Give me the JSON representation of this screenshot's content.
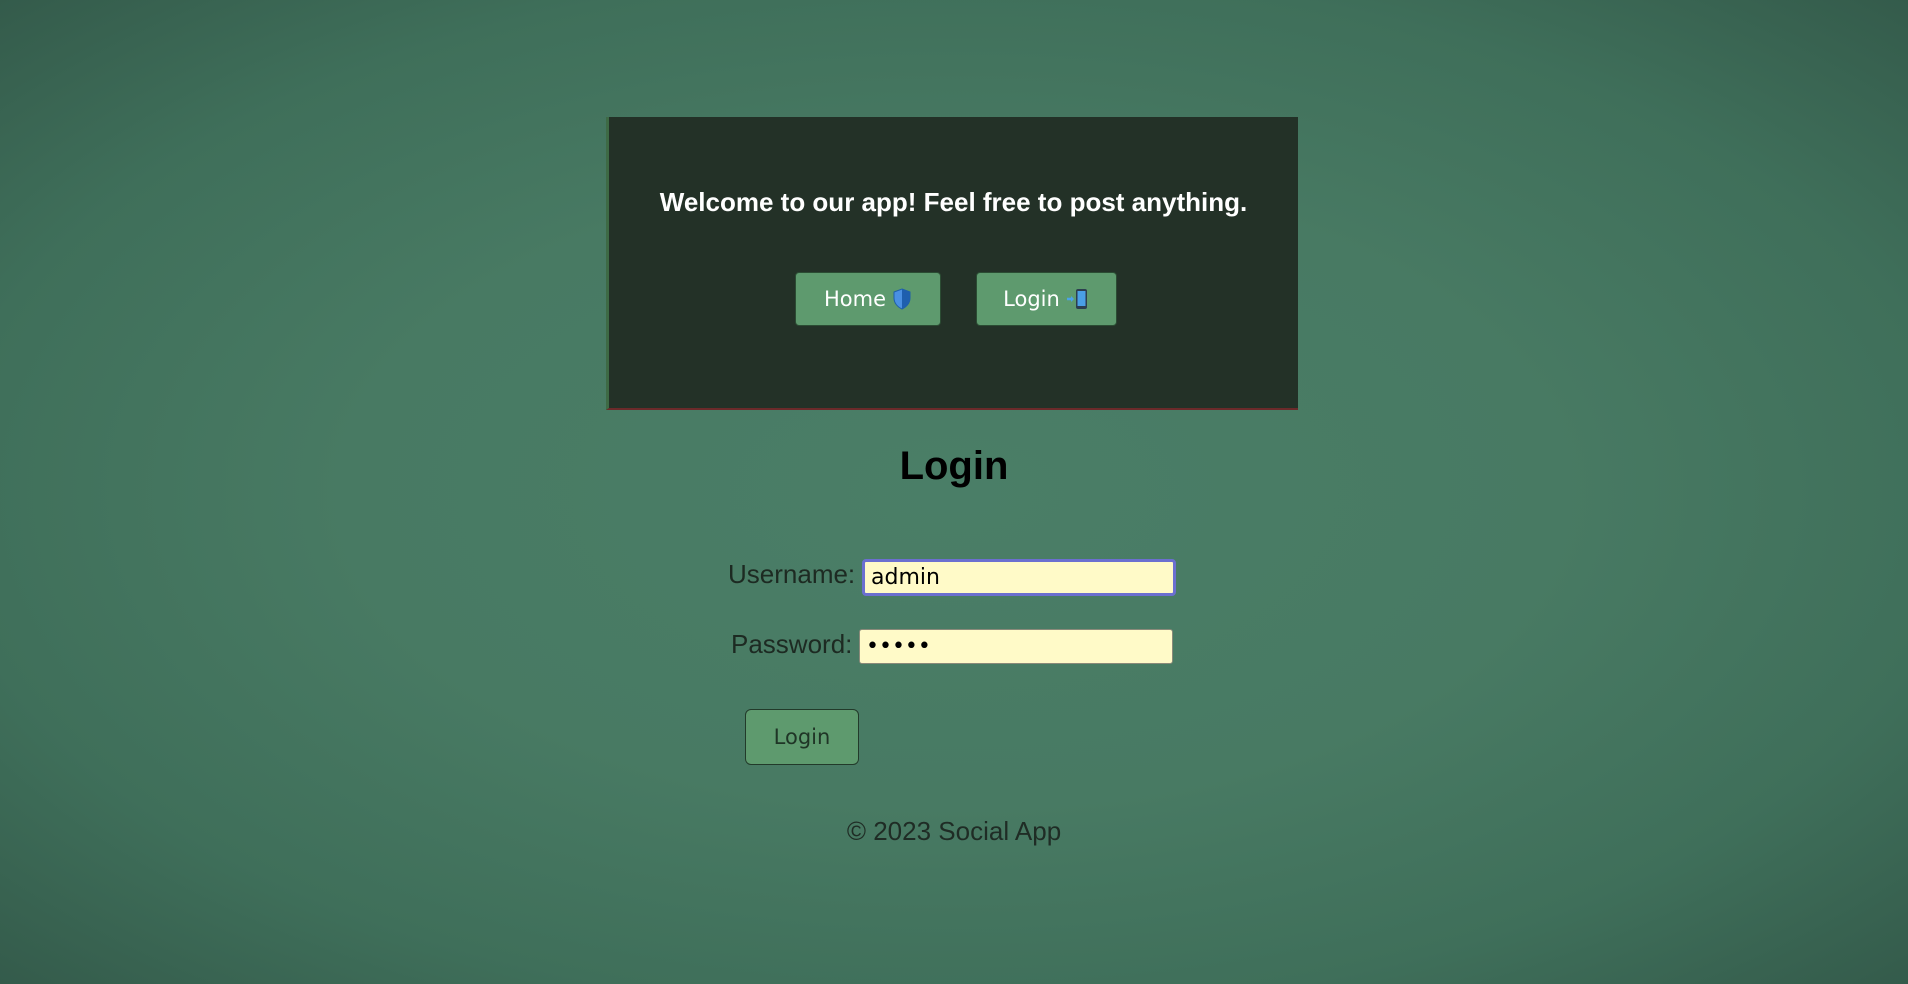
{
  "header": {
    "title": "Welcome to our app! Feel free to post anything.",
    "nav": {
      "home_label": "Home",
      "home_icon": "shield-icon",
      "login_label": "Login",
      "login_icon": "mobile-arrow-icon"
    }
  },
  "login_form": {
    "heading": "Login",
    "username_label": "Username:",
    "username_value": "admin",
    "password_label": "Password:",
    "password_value": "•••••",
    "submit_label": "Login"
  },
  "footer": {
    "text": "© 2023 Social App"
  },
  "colors": {
    "background": "#4a7e67",
    "header_bg": "#233127",
    "button_bg": "#5e9a6e",
    "input_bg": "#fffac8",
    "focus_border": "#6b6fd0"
  }
}
